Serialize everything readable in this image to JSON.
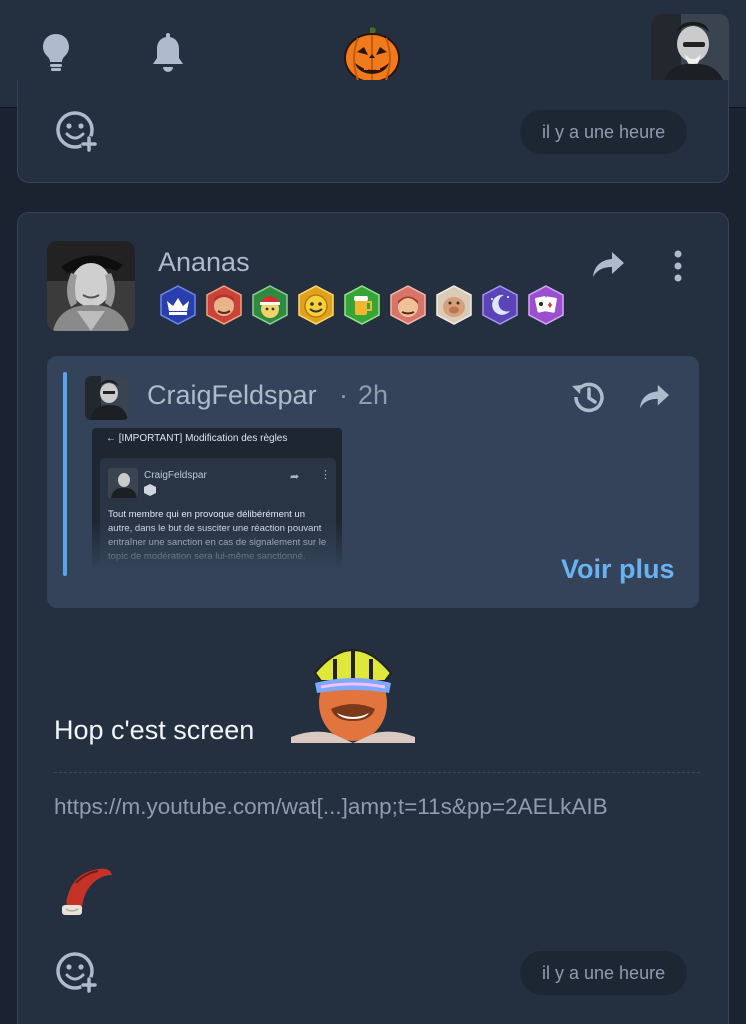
{
  "header": {
    "icons": [
      "lightbulb-icon",
      "bell-icon",
      "halloween-pumpkin-logo",
      "user-avatar"
    ]
  },
  "previous_post": {
    "react_icon": "add-reaction-icon",
    "time": "il y a une heure"
  },
  "post": {
    "author": "Ananas",
    "badges": [
      "crown-badge",
      "face-badge-red",
      "santa-badge",
      "smiley-badge-yellow",
      "beer-badge",
      "face-badge-pink",
      "pig-badge",
      "moon-badge",
      "cards-badge"
    ],
    "quote": {
      "author": "CraigFeldspar",
      "separator": "·",
      "time": "2h",
      "screenshot": {
        "header": "← [IMPORTANT] Modification des règles",
        "author": "CraigFeldspar",
        "text": "Tout membre qui en provoque délibérément un autre, dans le but de susciter une réaction pouvant entraîner une sanction en cas de signalement sur le topic de modération sera lui-même sanctionné."
      },
      "more_label": "Voir plus"
    },
    "message": "Hop c'est screen",
    "link": "https://m.youtube.com/wat[...]amp;t=11s&pp=2AELkAIB",
    "time": "il y a une heure"
  },
  "colors": {
    "background": "#1b2330",
    "card": "#243040",
    "quote": "#344359",
    "accent": "#69b2f2",
    "muted": "#8f9cad"
  }
}
